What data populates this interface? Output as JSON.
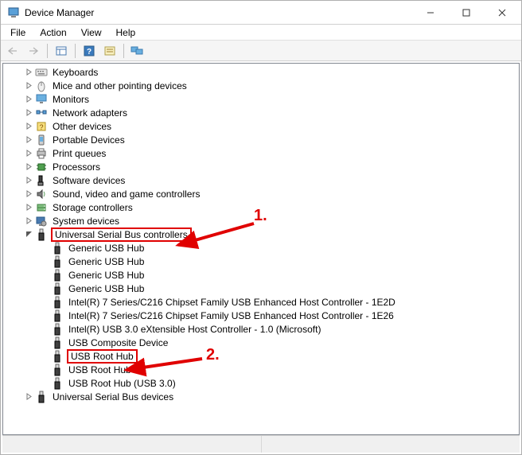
{
  "window": {
    "title": "Device Manager"
  },
  "menubar": {
    "items": [
      "File",
      "Action",
      "View",
      "Help"
    ]
  },
  "toolbar": {
    "back": "Back",
    "forward": "Forward",
    "prop": "Properties",
    "help": "Help",
    "scan": "Scan",
    "monitors": "Monitors"
  },
  "annotations": {
    "label1": "1.",
    "label2": "2."
  },
  "tree": {
    "top": [
      {
        "label": "Keyboards",
        "icon": "keyboard"
      },
      {
        "label": "Mice and other pointing devices",
        "icon": "mouse"
      },
      {
        "label": "Monitors",
        "icon": "monitor"
      },
      {
        "label": "Network adapters",
        "icon": "network"
      },
      {
        "label": "Other devices",
        "icon": "other"
      },
      {
        "label": "Portable Devices",
        "icon": "portable"
      },
      {
        "label": "Print queues",
        "icon": "printer"
      },
      {
        "label": "Processors",
        "icon": "cpu"
      },
      {
        "label": "Software devices",
        "icon": "software"
      },
      {
        "label": "Sound, video and game controllers",
        "icon": "sound"
      },
      {
        "label": "Storage controllers",
        "icon": "storage"
      },
      {
        "label": "System devices",
        "icon": "system"
      }
    ],
    "usb": {
      "label": "Universal Serial Bus controllers",
      "children": [
        "Generic USB Hub",
        "Generic USB Hub",
        "Generic USB Hub",
        "Generic USB Hub",
        "Intel(R) 7 Series/C216 Chipset Family USB Enhanced Host Controller - 1E2D",
        "Intel(R) 7 Series/C216 Chipset Family USB Enhanced Host Controller - 1E26",
        "Intel(R) USB 3.0 eXtensible Host Controller - 1.0 (Microsoft)",
        "USB Composite Device",
        "USB Root Hub",
        "USB Root Hub",
        "USB Root Hub (USB 3.0)"
      ]
    },
    "bottom": [
      {
        "label": "Universal Serial Bus devices",
        "icon": "usb"
      }
    ]
  }
}
